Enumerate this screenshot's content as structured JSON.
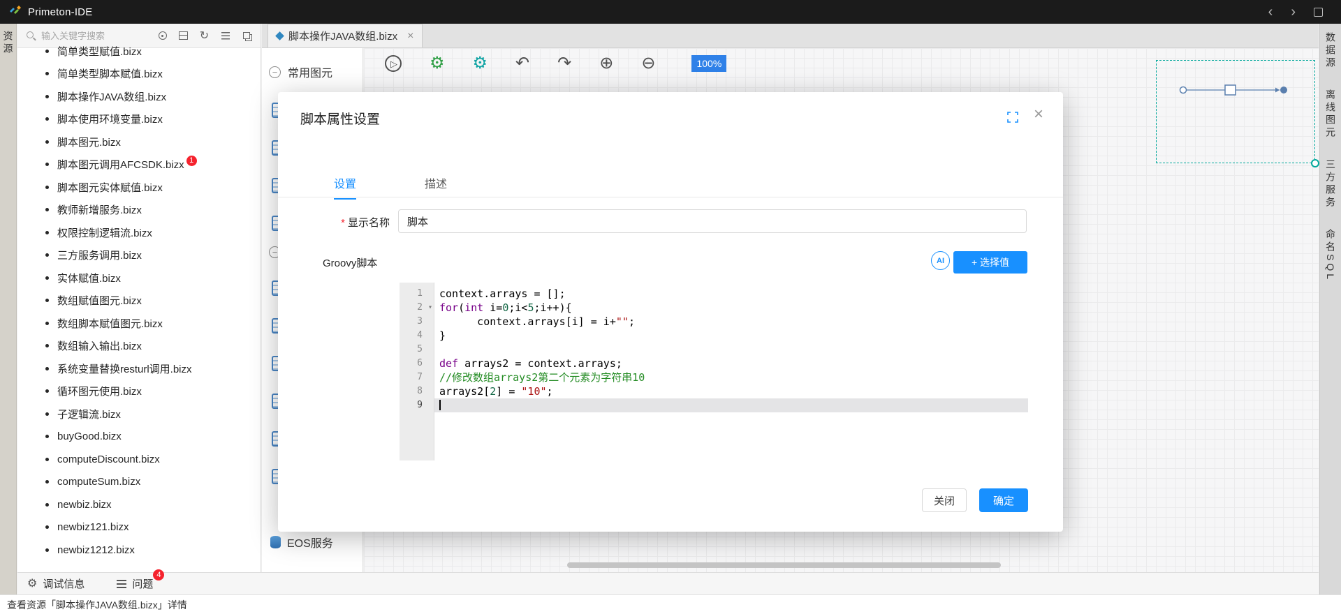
{
  "app": {
    "title": "Primeton-IDE"
  },
  "title_bar": {
    "back_glyph": "‹",
    "forward_glyph": "›"
  },
  "left_rail": {
    "label": "资源"
  },
  "explorer": {
    "search_placeholder": "输入关键字搜索",
    "toolbar_icons": [
      {
        "name": "locate-icon",
        "glyph": ""
      },
      {
        "name": "package-icon",
        "glyph": ""
      },
      {
        "name": "refresh-icon",
        "glyph": "↻"
      },
      {
        "name": "list-icon",
        "glyph": ""
      },
      {
        "name": "export-icon",
        "glyph": ""
      }
    ],
    "files": [
      {
        "name": "简单类型赋值.bizx"
      },
      {
        "name": "简单类型脚本赋值.bizx"
      },
      {
        "name": "脚本操作JAVA数组.bizx"
      },
      {
        "name": "脚本使用环境变量.bizx"
      },
      {
        "name": "脚本图元.bizx"
      },
      {
        "name": "脚本图元调用AFCSDK.bizx",
        "badge": "1"
      },
      {
        "name": "脚本图元实体赋值.bizx"
      },
      {
        "name": "教师新增服务.bizx"
      },
      {
        "name": "权限控制逻辑流.bizx"
      },
      {
        "name": "三方服务调用.bizx"
      },
      {
        "name": "实体赋值.bizx"
      },
      {
        "name": "数组赋值图元.bizx"
      },
      {
        "name": "数组脚本赋值图元.bizx"
      },
      {
        "name": "数组输入输出.bizx"
      },
      {
        "name": "系统变量替换resturl调用.bizx"
      },
      {
        "name": "循环图元使用.bizx"
      },
      {
        "name": "子逻辑流.bizx"
      },
      {
        "name": "buyGood.bizx"
      },
      {
        "name": "computeDiscount.bizx"
      },
      {
        "name": "computeSum.bizx"
      },
      {
        "name": "newbiz.bizx"
      },
      {
        "name": "newbiz121.bizx"
      },
      {
        "name": "newbiz1212.bizx"
      }
    ]
  },
  "tab_bar": {
    "tabs": [
      {
        "label": "脚本操作JAVA数组.bizx",
        "close_glyph": "×",
        "active": true
      }
    ]
  },
  "palette": {
    "collapse_glyph": "−",
    "sections": [
      {
        "label": "常用图元",
        "item_count": 4
      },
      {
        "label": "",
        "item_count": 6
      }
    ],
    "footer_label": "EOS服务"
  },
  "canvas": {
    "toolbar": [
      {
        "name": "run-debug-icon",
        "glyph": "▷"
      },
      {
        "name": "debug-bug-icon",
        "glyph": "⚙"
      },
      {
        "name": "debug-config-icon",
        "glyph": "⚙"
      },
      {
        "name": "undo-icon",
        "glyph": "↶"
      },
      {
        "name": "redo-icon",
        "glyph": "↷"
      },
      {
        "name": "zoom-in-icon",
        "glyph": "⊕"
      },
      {
        "name": "zoom-out-icon",
        "glyph": "⊖"
      }
    ],
    "zoom": "100%"
  },
  "right_rail": {
    "items": [
      "数据源",
      "离线图元",
      "三方服务",
      "命名SQL"
    ]
  },
  "bottom_bar": {
    "debug_icon_glyph": "⚙",
    "tabs": [
      {
        "label": "调试信息"
      },
      {
        "label": "问题",
        "badge": "4"
      }
    ]
  },
  "status_bar": {
    "text": "查看资源「脚本操作JAVA数组.bizx」详情"
  },
  "modal": {
    "title": "脚本属性设置",
    "close_glyph": "×",
    "tabs": [
      {
        "label": "设置",
        "active": true
      },
      {
        "label": "描述"
      }
    ],
    "display_name": {
      "required_mark": "*",
      "label": "显示名称",
      "value": "脚本"
    },
    "script": {
      "label": "Groovy脚本",
      "ai_label": "AI",
      "select_value_button": "+ 选择值",
      "fold_glyph": "▾",
      "lines": [
        {
          "n": "1",
          "tokens": [
            {
              "c": "pl",
              "t": "context.arrays = [];"
            }
          ]
        },
        {
          "n": "2",
          "fold": true,
          "tokens": [
            {
              "c": "kw",
              "t": "for"
            },
            {
              "c": "pl",
              "t": "("
            },
            {
              "c": "kw",
              "t": "int"
            },
            {
              "c": "pl",
              "t": " i="
            },
            {
              "c": "num",
              "t": "0"
            },
            {
              "c": "pl",
              "t": ";i<"
            },
            {
              "c": "num",
              "t": "5"
            },
            {
              "c": "pl",
              "t": ";i++){"
            }
          ]
        },
        {
          "n": "3",
          "tokens": [
            {
              "c": "pl",
              "t": "      context.arrays[i] = i+"
            },
            {
              "c": "str",
              "t": "\"\""
            },
            {
              "c": "pl",
              "t": ";"
            }
          ]
        },
        {
          "n": "4",
          "tokens": [
            {
              "c": "pl",
              "t": "}"
            }
          ]
        },
        {
          "n": "5",
          "tokens": []
        },
        {
          "n": "6",
          "tokens": [
            {
              "c": "kw",
              "t": "def"
            },
            {
              "c": "pl",
              "t": " arrays2 = context.arrays;"
            }
          ]
        },
        {
          "n": "7",
          "tokens": [
            {
              "c": "cmt",
              "t": "//修改数组arrays2第二个元素为字符串10"
            }
          ]
        },
        {
          "n": "8",
          "tokens": [
            {
              "c": "pl",
              "t": "arrays2["
            },
            {
              "c": "num",
              "t": "2"
            },
            {
              "c": "pl",
              "t": "] = "
            },
            {
              "c": "str",
              "t": "\"10\""
            },
            {
              "c": "pl",
              "t": ";"
            }
          ]
        },
        {
          "n": "9",
          "active": true,
          "tokens": []
        }
      ]
    },
    "footer": {
      "close_label": "关闭",
      "ok_label": "确定"
    }
  },
  "colors": {
    "accent": "#1890ff",
    "danger": "#f5222d",
    "selection_teal": "#00a89b",
    "keyword": "#770088",
    "number": "#116644",
    "string": "#aa1111",
    "comment": "#228b22"
  }
}
